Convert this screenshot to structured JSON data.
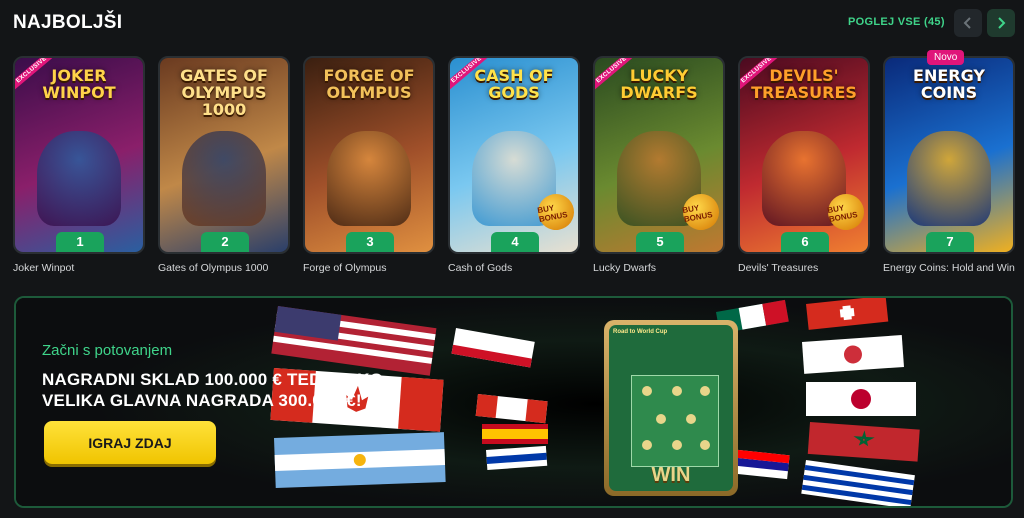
{
  "section": {
    "title": "NAJBOLJŠI",
    "view_all": "POGLEJ VSE (45)"
  },
  "games": [
    {
      "rank": "1",
      "name": "Joker Winpot",
      "logo": "JOKER WINPOT",
      "badge": "EXCLUSIVE",
      "bonus": "",
      "colors": [
        "#3a0d4a",
        "#8a1f6a",
        "#2a5fa0"
      ]
    },
    {
      "rank": "2",
      "name": "Gates of Olympus 1000",
      "logo": "GATES OF OLYMPUS 1000",
      "badge": "",
      "bonus": "",
      "colors": [
        "#6a3a20",
        "#c08848",
        "#2a3f6a"
      ]
    },
    {
      "rank": "3",
      "name": "Forge of Olympus",
      "logo": "FORGE OF OLYMPUS",
      "badge": "",
      "bonus": "",
      "colors": [
        "#3a1f10",
        "#a0502a",
        "#e09040"
      ]
    },
    {
      "rank": "4",
      "name": "Cash of Gods",
      "logo": "CASH OF GODS",
      "badge": "EXCLUSIVE",
      "bonus": "BUY BONUS",
      "colors": [
        "#2a8fd0",
        "#7ac8f0",
        "#e8e0d0"
      ]
    },
    {
      "rank": "5",
      "name": "Lucky Dwarfs",
      "logo": "LUCKY DWARFS",
      "badge": "EXCLUSIVE",
      "bonus": "BUY BONUS",
      "colors": [
        "#2a4a20",
        "#6a8a30",
        "#c07830"
      ]
    },
    {
      "rank": "6",
      "name": "Devils' Treasures",
      "logo": "DEVILS' TREASURES",
      "badge": "EXCLUSIVE",
      "bonus": "BUY BONUS",
      "colors": [
        "#4a0a20",
        "#c02a30",
        "#f08030"
      ]
    },
    {
      "rank": "7",
      "name": "Energy Coins: Hold and Win",
      "logo": "ENERGY COINS",
      "badge": "",
      "bonus": "",
      "colors": [
        "#0a2a7a",
        "#1a70d0",
        "#f0b020"
      ],
      "tag": "Novo"
    }
  ],
  "banner": {
    "subtitle": "Začni s potovanjem",
    "headline_1": "NAGRADNI SKLAD 100.000 € TEDENSKO.",
    "headline_2": "VELIKA GLAVNA NAGRADA 300.000 €!",
    "button": "IGRAJ ZDAJ",
    "card_label": "Road to World Cup",
    "card_win": "WIN"
  }
}
